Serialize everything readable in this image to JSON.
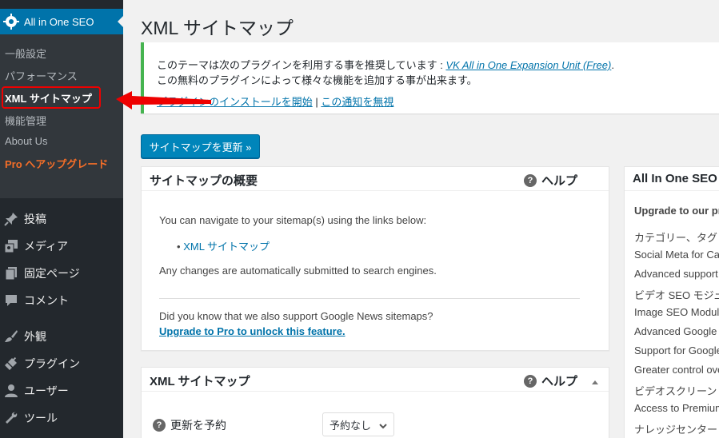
{
  "sidebar": {
    "plugin_title": "All in One SEO",
    "submenu": [
      {
        "label": "一般設定"
      },
      {
        "label": "パフォーマンス"
      },
      {
        "label": "XML サイトマップ"
      },
      {
        "label": "機能管理"
      },
      {
        "label": "About Us"
      },
      {
        "label": "Pro へアップグレード"
      }
    ],
    "menu": [
      {
        "label": "投稿",
        "icon": "pin-icon"
      },
      {
        "label": "メディア",
        "icon": "media-icon"
      },
      {
        "label": "固定ページ",
        "icon": "page-icon"
      },
      {
        "label": "コメント",
        "icon": "comment-icon"
      },
      {
        "label": "外観",
        "icon": "brush-icon"
      },
      {
        "label": "プラグイン",
        "icon": "plugin-icon"
      },
      {
        "label": "ユーザー",
        "icon": "user-icon"
      },
      {
        "label": "ツール",
        "icon": "wrench-icon"
      }
    ]
  },
  "main": {
    "page_title": "XML サイトマップ",
    "notice": {
      "line1_prefix": "このテーマは次のプラグインを利用する事を推奨しています : ",
      "line1_link": "VK All in One Expansion Unit (Free)",
      "line1_suffix": ".",
      "line2": "この無料のプラグインによって様々な機能を追加する事が出来ます。",
      "install_link": "プラグインのインストールを開始",
      "separator": " | ",
      "dismiss_link": "この通知を無視"
    },
    "update_button": "サイトマップを更新 »",
    "overview_box": {
      "title": "サイトマップの概要",
      "help": "ヘルプ",
      "intro": "You can navigate to your sitemap(s) using the links below:",
      "bullet": "•",
      "sitemap_link": "XML サイトマップ",
      "auto_submit": "Any changes are automatically submitted to search engines.",
      "news_question": "Did you know that we also support Google News sitemaps?",
      "upgrade_link": "Upgrade to Pro to unlock this feature."
    },
    "xml_box": {
      "title": "XML サイトマップ",
      "help": "ヘルプ",
      "schedule_label": "更新を予約",
      "schedule_value": "予約なし"
    },
    "side_box": {
      "title": "All In One SEO",
      "subtitle": "Upgrade to our pr",
      "items": [
        "カテゴリー、タグ",
        "Social Meta for Cat",
        "Advanced support",
        "ビデオ SEO モジュ",
        "Image SEO Module",
        "Advanced Google",
        "Support for Google",
        "Greater control ove",
        "ビデオスクリーン",
        "Access to Premium",
        "ナレッジセンター"
      ]
    }
  }
}
